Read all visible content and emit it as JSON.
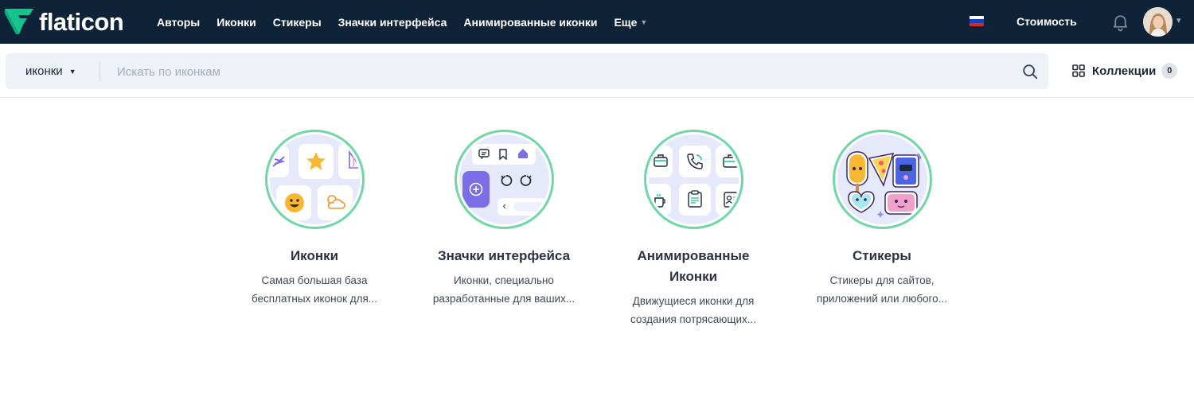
{
  "brand": {
    "name": "flaticon",
    "color": "#14c48c"
  },
  "nav": {
    "items": [
      "Авторы",
      "Иконки",
      "Стикеры",
      "Значки интерфейса",
      "Анимированные иконки"
    ],
    "more_label": "Еще",
    "pricing_label": "Стоимость",
    "language_flag": "russia-flag",
    "bell_icon": "bell-icon"
  },
  "search": {
    "scope_label": "иконки",
    "placeholder": "Искать по иконкам",
    "value": "",
    "button_icon": "search-icon"
  },
  "collections": {
    "label": "Коллекции",
    "count": "0",
    "icon": "grid-icon"
  },
  "categories": [
    {
      "title": "Иконки",
      "desc_line1": "Самая большая база",
      "desc_line2": "бесплатных иконок для..."
    },
    {
      "title": "Значки интерфейса",
      "desc_line1": "Иконки, специально",
      "desc_line2": "разработанные для ваших..."
    },
    {
      "title_line1": "Анимированные",
      "title_line2": "Иконки",
      "desc_line1": "Движущиеся иконки для",
      "desc_line2": "создания потрясающих..."
    },
    {
      "title": "Стикеры",
      "desc_line1": "Стикеры для сайтов,",
      "desc_line2": "приложений или любого..."
    }
  ],
  "colors": {
    "topbar": "#0f2338",
    "accent_ring": "#6fd6a5",
    "search_bg": "#eef1f5"
  }
}
